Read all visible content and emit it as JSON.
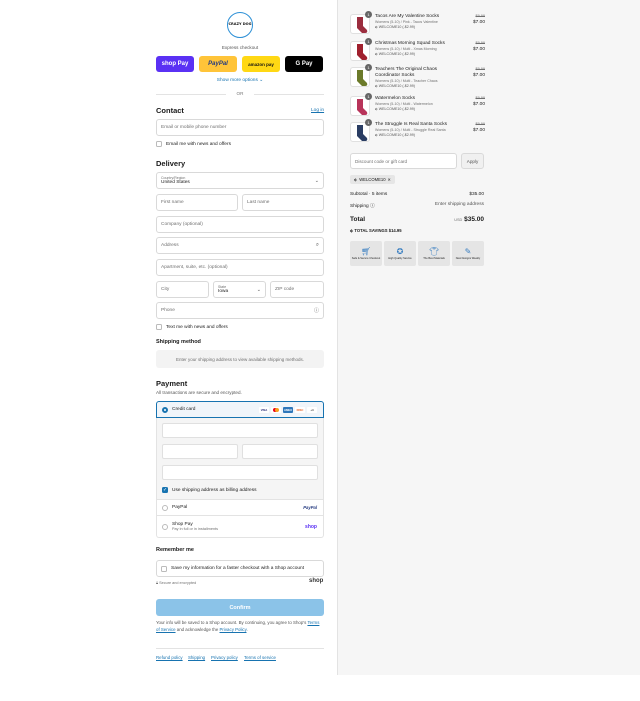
{
  "brand": {
    "logo_text": "CRAZY DOG",
    "express_checkout": "Express checkout"
  },
  "express": {
    "shop": "shop Pay",
    "paypal": "PayPal",
    "amazon": "amazon pay",
    "gpay": "G Pay",
    "more": "Show more options ⌄",
    "or": "OR"
  },
  "contact": {
    "title": "Contact",
    "login": "Log in",
    "email_placeholder": "Email or mobile phone number",
    "news": "Email me with news and offers"
  },
  "delivery": {
    "title": "Delivery",
    "country_label": "Country/Region",
    "country_value": "United States",
    "first_name": "First name",
    "last_name": "Last name",
    "company": "Company (optional)",
    "address": "Address",
    "apartment": "Apartment, suite, etc. (optional)",
    "city": "City",
    "state_label": "State",
    "state_value": "Iowa",
    "zip": "ZIP code",
    "phone": "Phone",
    "text_news": "Text me with news and offers"
  },
  "shipping": {
    "title": "Shipping method",
    "notice": "Enter your shipping address to view available shipping methods."
  },
  "payment": {
    "title": "Payment",
    "subtitle": "All transactions are secure and encrypted.",
    "credit_card": "Credit card",
    "billing_same": "Use shipping address as billing address",
    "paypal": "PayPal",
    "paypal_logo": "PayPal",
    "shop_pay": "Shop Pay",
    "shop_pay_sub": "Pay in full or in installments",
    "shop_logo": "shop",
    "cards": [
      "VISA",
      "MC",
      "AMEX",
      "DISC",
      "+4"
    ]
  },
  "remember": {
    "title": "Remember me",
    "save": "Save my information for a faster checkout with a Shop account",
    "secure": "Secure and encrypted",
    "shop": "shop"
  },
  "confirm": "Confirm",
  "legal": {
    "pre": "Your info will be saved to a Shop account. By continuing, you agree to Shop's",
    "tos": "Terms of Service",
    "mid": "and acknowledge the",
    "privacy": "Privacy Policy",
    "end": "."
  },
  "footer": [
    "Refund policy",
    "Shipping",
    "Privacy policy",
    "Terms of service"
  ],
  "cart": {
    "items": [
      {
        "name": "Tacos Are My Valentine Socks",
        "variant": "Womens (5-10) / Pink - Tacos Valentine",
        "discount": "WELCOME10 (-$2.99)",
        "old": "$9.99",
        "price": "$7.00",
        "qty": "1",
        "color": "#9b2d3e"
      },
      {
        "name": "Christmas Morning Squad Socks",
        "variant": "Womens (5-10) / Multi - Xmas Morning",
        "discount": "WELCOME10 (-$2.99)",
        "old": "$9.99",
        "price": "$7.00",
        "qty": "1",
        "color": "#a0202e"
      },
      {
        "name": "Teachers The Original Chaos Coordinator Socks",
        "variant": "Womens (5-10) / Multi - Teacher Chaos",
        "discount": "WELCOME10 (-$2.99)",
        "old": "$9.99",
        "price": "$7.00",
        "qty": "1",
        "color": "#6b7a2a"
      },
      {
        "name": "Watermelon Socks",
        "variant": "Womens (5-10) / Multi - Watermelon",
        "discount": "WELCOME10 (-$2.99)",
        "old": "$9.99",
        "price": "$7.00",
        "qty": "1",
        "color": "#b8345a"
      },
      {
        "name": "The Struggle Is Real Santa Socks",
        "variant": "Womens (5-10) / Multi - Struggle Real Santa",
        "discount": "WELCOME10 (-$2.99)",
        "old": "$9.99",
        "price": "$7.00",
        "qty": "1",
        "color": "#2a3d63"
      }
    ],
    "discount_placeholder": "Discount code or gift card",
    "apply": "Apply",
    "applied_code": "WELCOME10",
    "subtotal_label": "Subtotal · 5 items",
    "subtotal": "$35.00",
    "shipping_label": "Shipping ⓘ",
    "shipping_value": "Enter shipping address",
    "total_label": "Total",
    "currency": "USD",
    "total": "$35.00",
    "savings_label": "TOTAL SAVINGS",
    "savings": "$14.95",
    "badges": [
      "Safe & Secure Checkout",
      "High Quality Service",
      "The Best Materials",
      "New Designs Weekly"
    ]
  }
}
